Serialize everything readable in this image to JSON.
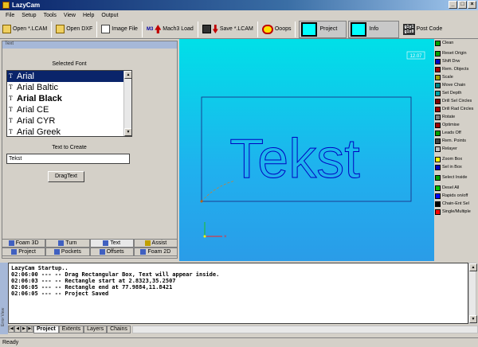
{
  "window": {
    "title": "LazyCam"
  },
  "menu": [
    "File",
    "Setup",
    "Tools",
    "View",
    "Help",
    "Output"
  ],
  "toolbar": {
    "open_lcam": "Open *.LCAM",
    "open_dxf": "Open DXF",
    "image_file": "Image File",
    "m3_badge": "M3",
    "mach3_load": "Mach3 Load",
    "save_lcam": "Save *.LCAM",
    "ooops": "Ooops",
    "project": "Project",
    "info": "Info",
    "glyph_line1": "g1y1",
    "glyph_line2": "g1x0",
    "post_code": "Post Code"
  },
  "left_panel": {
    "caption": "Text",
    "selected_font_label": "Selected Font",
    "fonts": [
      "Arial",
      "Arial Baltic",
      "Arial Black",
      "Arial CE",
      "Arial CYR",
      "Arial Greek"
    ],
    "selected_font_index": 0,
    "text_to_create_label": "Text to Create",
    "text_value": "Tekst",
    "drag_text_button": "DragText"
  },
  "panel_tabs": [
    [
      "Foam 3D",
      "Turn",
      "Text",
      "Assist"
    ],
    [
      "Project",
      "Pockets",
      "Offsets",
      "Foam 2D"
    ]
  ],
  "viewport": {
    "zoom_label": "12.07",
    "text": "Tekst"
  },
  "right_buttons": [
    {
      "label": "Clean",
      "color": "#00a000"
    },
    {
      "gap": true
    },
    {
      "label": "Reset Origin",
      "color": "#00a000"
    },
    {
      "label": "Shift Drw",
      "color": "#0000c0"
    },
    {
      "label": "Rem. Objects",
      "color": "#a00000"
    },
    {
      "label": "Scale",
      "color": "#a0a000"
    },
    {
      "label": "Move Chain",
      "color": "#008080"
    },
    {
      "label": "Set Depth",
      "color": "#00a0a0"
    },
    {
      "label": "Drill Sel Circles",
      "color": "#800000"
    },
    {
      "label": "Drill Rad Circles",
      "color": "#a00000"
    },
    {
      "label": "Rotate",
      "color": "#808080"
    },
    {
      "label": "Optimise",
      "color": "#a00000"
    },
    {
      "label": "Leads Off",
      "color": "#00a000"
    },
    {
      "label": "Rem. Points",
      "color": "#404040"
    },
    {
      "label": "Relayer",
      "color": "#c0c0c0"
    },
    {
      "gap": true
    },
    {
      "label": "Zoom Box",
      "color": "#ffff00"
    },
    {
      "label": "Sel in Box",
      "color": "#0000c0"
    },
    {
      "gap": true
    },
    {
      "label": "Select Inside",
      "color": "#00a000"
    },
    {
      "gap": true
    },
    {
      "label": "Desel All",
      "color": "#00c000"
    },
    {
      "label": "Rapids on/off",
      "color": "#0000ff"
    },
    {
      "label": "Chain-Ent Sel",
      "color": "#000000"
    },
    {
      "label": "Single/Multiple",
      "color": "#ff0000"
    }
  ],
  "console": {
    "lines": [
      "LazyCam Startup..",
      "02:06:00 --- -- Drag Rectangular Box, Text will appear inside.",
      "02:06:03 --- -- Rectangle start at 2.8323,35.2507",
      "02:06:05 --- -- Rectangle end at 77.9884,11.8421",
      "02:06:05 --- -- Project Saved"
    ],
    "side_label": "Error View"
  },
  "bottom_tabs": [
    "Project",
    "Extents",
    "Layers",
    "Chains"
  ],
  "status": "Ready"
}
